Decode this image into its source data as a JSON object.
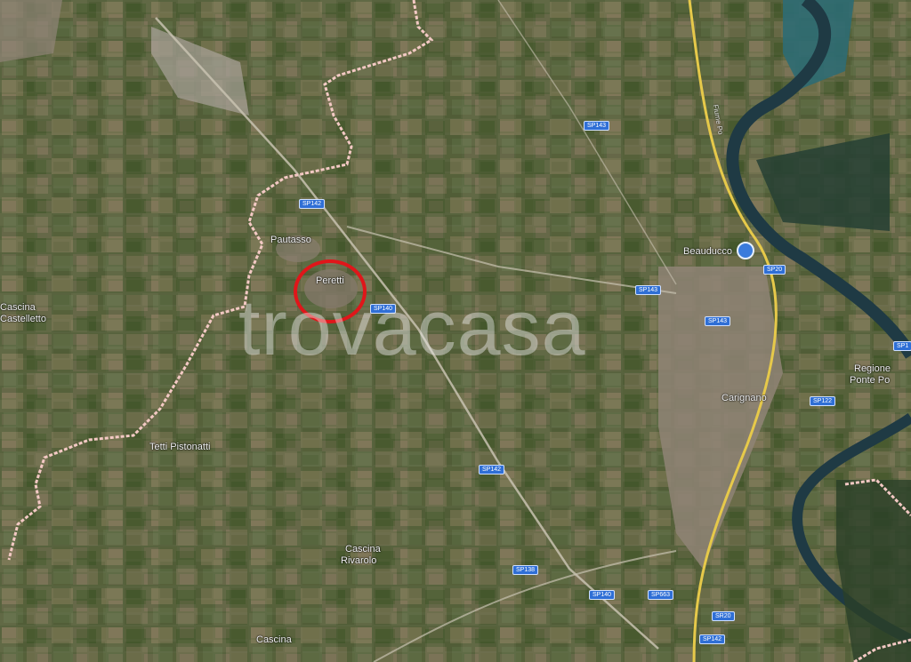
{
  "map": {
    "places": {
      "pautasso": "Pautasso",
      "peretti": "Peretti",
      "cascina_castelletto_1": "Cascina",
      "cascina_castelletto_2": "Castelletto",
      "tetti_pistonatti": "Tetti Pistonatti",
      "cascina_rivarolo_1": "Cascina",
      "cascina_rivarolo_2": "Rivarolo",
      "cascina_bottom": "Cascina",
      "beaudocco": "Beauducco",
      "carignano": "Carignano",
      "regione_ponte_po_1": "Regione",
      "regione_ponte_po_2": "Ponte Po"
    },
    "roads": [
      "SP143",
      "SP142",
      "SP140",
      "SP143",
      "SP143",
      "SP20",
      "SP122",
      "SP142",
      "SP138",
      "SP140",
      "SP663",
      "SR20",
      "SP142",
      "SP1"
    ],
    "river_label": "Fiume Po",
    "watermark": "trovacasa",
    "colors": {
      "boundary": "#f3c9c4",
      "river": "#1f3a44",
      "highway": "#e6c94a",
      "marker": "#e0161a",
      "road_shield": "#2f6fd6"
    }
  }
}
